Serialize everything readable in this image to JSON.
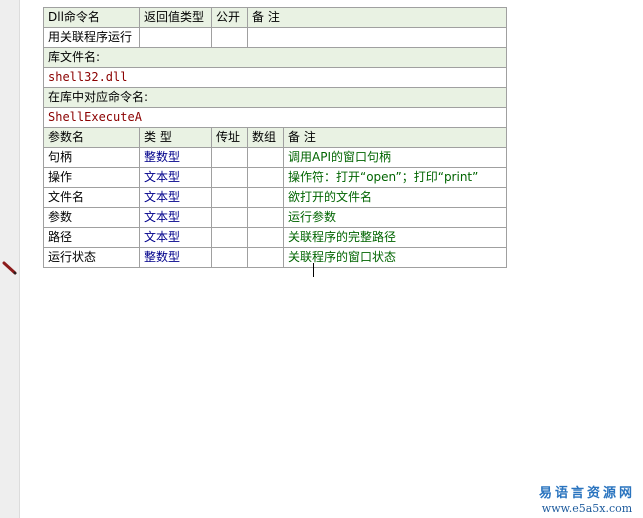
{
  "dll_header": {
    "col_name": "Dll命令名",
    "col_return_type": "返回值类型",
    "col_public": "公开",
    "col_remark": "备 注"
  },
  "dll_command": {
    "name": "用关联程序运行",
    "return_type": "",
    "public": "",
    "remark": ""
  },
  "lib_file_label": "库文件名:",
  "lib_file_value": "shell32.dll",
  "entry_label": "在库中对应命令名:",
  "entry_value": "ShellExecuteA",
  "param_header": {
    "col_name": "参数名",
    "col_type": "类 型",
    "col_byref": "传址",
    "col_array": "数组",
    "col_remark": "备 注"
  },
  "params": [
    {
      "name": "句柄",
      "type": "整数型",
      "byref": "",
      "array": "",
      "remark": "调用API的窗口句柄"
    },
    {
      "name": "操作",
      "type": "文本型",
      "byref": "",
      "array": "",
      "remark": "操作符：打开“open”；打印“print”"
    },
    {
      "name": "文件名",
      "type": "文本型",
      "byref": "",
      "array": "",
      "remark": "欲打开的文件名"
    },
    {
      "name": "参数",
      "type": "文本型",
      "byref": "",
      "array": "",
      "remark": "运行参数"
    },
    {
      "name": "路径",
      "type": "文本型",
      "byref": "",
      "array": "",
      "remark": "关联程序的完整路径"
    },
    {
      "name": "运行状态",
      "type": "整数型",
      "byref": "",
      "array": "",
      "remark": "关联程序的窗口状态"
    }
  ],
  "watermark": {
    "cn": "易语言资源网",
    "en": "www.e5a5x.com"
  },
  "icons": {
    "edit_marker": "pencil-icon"
  },
  "colors": {
    "header_bg": "#e9f2e3",
    "type_text": "#00008b",
    "remark_text": "#006400",
    "lib_text": "#8b0000",
    "brand_blue": "#2a74bf"
  }
}
